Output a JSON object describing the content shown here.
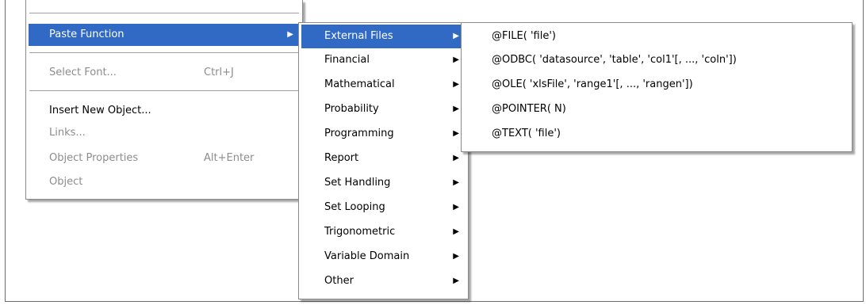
{
  "main_menu": {
    "items": [
      {
        "label": "Paste Function",
        "shortcut": "",
        "has_submenu": true,
        "disabled": false,
        "highlighted": true
      },
      {
        "label": "Select Font...",
        "shortcut": "Ctrl+J",
        "has_submenu": false,
        "disabled": true,
        "highlighted": false
      },
      {
        "label": "Insert New Object...",
        "shortcut": "",
        "has_submenu": false,
        "disabled": false,
        "highlighted": false
      },
      {
        "label": "Links...",
        "shortcut": "",
        "has_submenu": false,
        "disabled": true,
        "highlighted": false
      },
      {
        "label": "Object Properties",
        "shortcut": "Alt+Enter",
        "has_submenu": false,
        "disabled": true,
        "highlighted": false
      },
      {
        "label": "Object",
        "shortcut": "",
        "has_submenu": false,
        "disabled": true,
        "highlighted": false
      }
    ]
  },
  "function_categories": {
    "items": [
      {
        "label": "External Files",
        "highlighted": true
      },
      {
        "label": "Financial",
        "highlighted": false
      },
      {
        "label": "Mathematical",
        "highlighted": false
      },
      {
        "label": "Probability",
        "highlighted": false
      },
      {
        "label": "Programming",
        "highlighted": false
      },
      {
        "label": "Report",
        "highlighted": false
      },
      {
        "label": "Set Handling",
        "highlighted": false
      },
      {
        "label": "Set Looping",
        "highlighted": false
      },
      {
        "label": "Trigonometric",
        "highlighted": false
      },
      {
        "label": "Variable Domain",
        "highlighted": false
      },
      {
        "label": "Other",
        "highlighted": false
      }
    ]
  },
  "external_files_functions": {
    "items": [
      {
        "label": "@FILE( 'file')"
      },
      {
        "label": "@ODBC( 'datasource', 'table', 'col1'[, ..., 'coln'])"
      },
      {
        "label": "@OLE( 'xlsFile', 'range1'[, ..., 'rangen'])"
      },
      {
        "label": "@POINTER( N)"
      },
      {
        "label": "@TEXT( 'file')"
      }
    ]
  },
  "icons": {
    "submenu_arrow": "submenu-arrow-icon"
  },
  "colors": {
    "highlight": "#316ac5",
    "disabled_text": "#8c8c8c",
    "menu_bg": "#ffffff"
  }
}
